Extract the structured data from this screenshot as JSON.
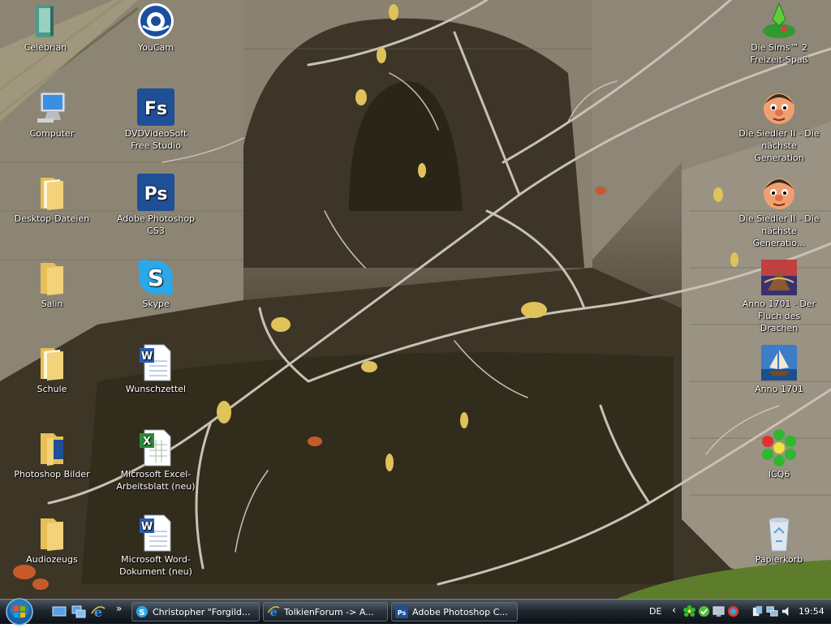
{
  "desktop": {
    "icons": [
      {
        "label": "Celebrian",
        "icon": "application-book-icon"
      },
      {
        "label": "YouCam",
        "icon": "youcam-icon"
      },
      {
        "label": "Computer",
        "icon": "computer-icon"
      },
      {
        "label": "DVDVideoSoft Free Studio",
        "icon": "fs-icon"
      },
      {
        "label": "Desktop-Dateien",
        "icon": "folder-icon"
      },
      {
        "label": "Adobe Photoshop CS3",
        "icon": "photoshop-icon"
      },
      {
        "label": "Salin",
        "icon": "folder-icon"
      },
      {
        "label": "Skype",
        "icon": "skype-icon"
      },
      {
        "label": "Schule",
        "icon": "folder-icon"
      },
      {
        "label": "Wunschzettel",
        "icon": "word-document-icon"
      },
      {
        "label": "Photoshop Bilder",
        "icon": "folder-icon"
      },
      {
        "label": "Microsoft Excel-Arbeitsblatt (neu)",
        "icon": "excel-document-icon"
      },
      {
        "label": "Audiozeugs",
        "icon": "folder-icon"
      },
      {
        "label": "Microsoft Word-Dokument (neu)",
        "icon": "word-document-icon"
      },
      {
        "label": "Die Sims™ 2 Freizeit-Spaß",
        "icon": "sims-icon"
      },
      {
        "label": "Die Siedler II - Die nächste Generation",
        "icon": "siedler-icon"
      },
      {
        "label": "Die Siedler II - Die nächste Generatio...",
        "icon": "siedler-icon"
      },
      {
        "label": "Anno 1701 - Der Fluch des Drachen",
        "icon": "anno-dragon-icon"
      },
      {
        "label": "Anno 1701",
        "icon": "anno-ship-icon"
      },
      {
        "label": "ICQ6",
        "icon": "icq-flower-icon"
      },
      {
        "label": "Papierkorb",
        "icon": "recycle-bin-icon"
      }
    ]
  },
  "taskbar": {
    "tasks": [
      {
        "label": "Christopher \"Forgild...",
        "icon": "skype-icon"
      },
      {
        "label": "TolkienForum -> A...",
        "icon": "internet-explorer-icon"
      },
      {
        "label": "Adobe Photoshop C...",
        "icon": "photoshop-icon"
      }
    ],
    "quicklaunch_overflow": "»",
    "tray": {
      "language": "DE",
      "chevron": "‹",
      "clock": "19:54"
    }
  },
  "colors": {
    "photoshop_blue": "#1f4f96",
    "taskbar_dark": "#0b1116",
    "folder_yellow": "#f2d27a",
    "icq_green": "#2fb82f"
  }
}
